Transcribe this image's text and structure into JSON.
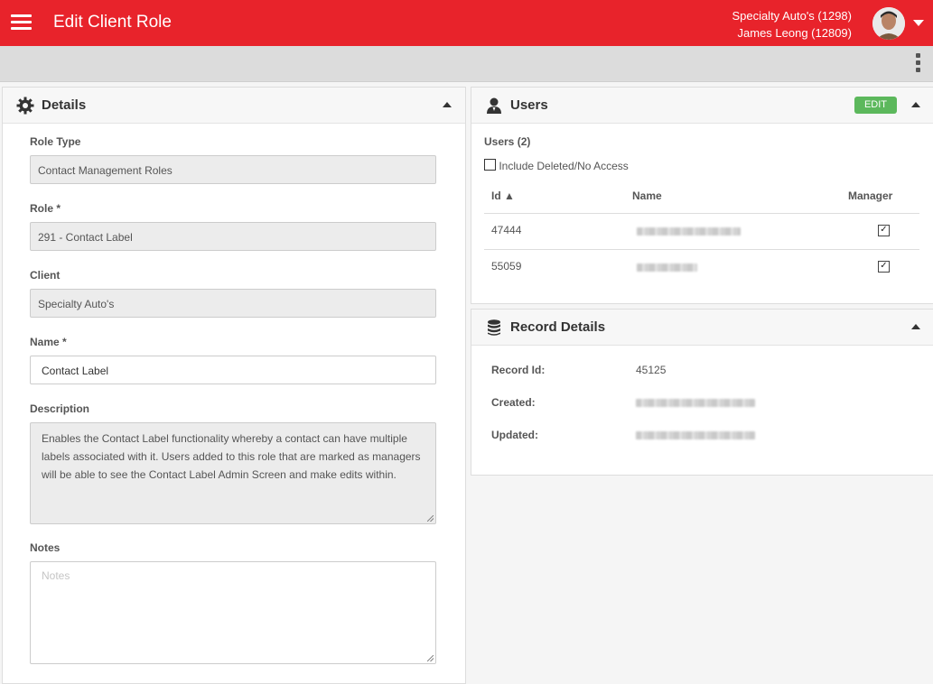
{
  "app": {
    "title": "Edit Client Role",
    "account_line1": "Specialty Auto's (1298)",
    "account_line2": "James Leong (12809)",
    "brand_color": "#e8232b"
  },
  "details": {
    "title": "Details",
    "role_type_label": "Role Type",
    "role_type_value": "Contact Management Roles",
    "role_label": "Role *",
    "role_value": "291 - Contact Label",
    "client_label": "Client",
    "client_value": "Specialty Auto's",
    "name_label": "Name *",
    "name_value": "Contact Label",
    "description_label": "Description",
    "description_value": "Enables the Contact Label functionality whereby a contact can have multiple labels associated with it. Users added to this role that are marked as managers will be able to see the Contact Label Admin Screen and make edits within.",
    "notes_label": "Notes",
    "notes_placeholder": "Notes"
  },
  "users": {
    "title": "Users",
    "edit_label": "EDIT",
    "count_label": "Users (2)",
    "include_deleted_label": "Include Deleted/No Access",
    "columns": {
      "id": "Id ▲",
      "name": "Name",
      "manager": "Manager"
    },
    "rows": [
      {
        "id": "47444",
        "manager": true
      },
      {
        "id": "55059",
        "manager": true
      }
    ]
  },
  "record": {
    "title": "Record Details",
    "record_id_label": "Record Id:",
    "record_id_value": "45125",
    "created_label": "Created:",
    "updated_label": "Updated:"
  }
}
